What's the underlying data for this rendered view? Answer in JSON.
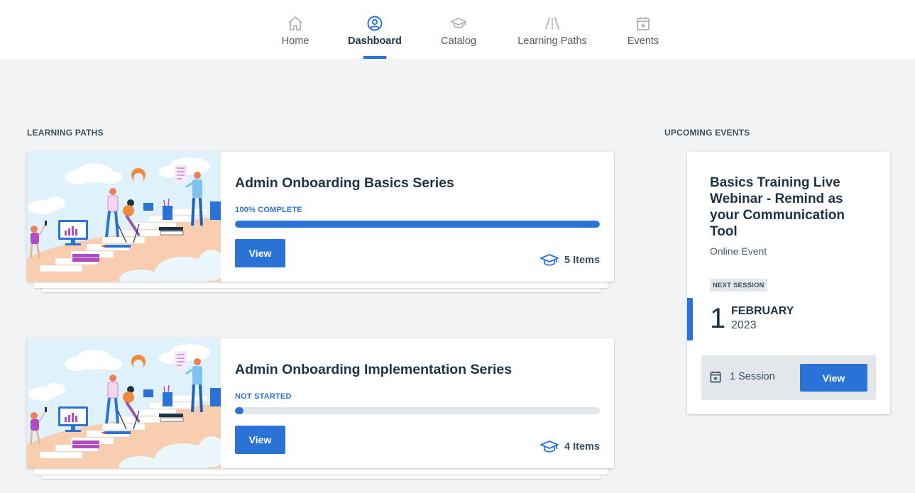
{
  "nav": {
    "items": [
      {
        "label": "Home",
        "icon": "home-icon",
        "active": false
      },
      {
        "label": "Dashboard",
        "icon": "user-circle-icon",
        "active": true
      },
      {
        "label": "Catalog",
        "icon": "graduation-cap-icon",
        "active": false
      },
      {
        "label": "Learning Paths",
        "icon": "road-icon",
        "active": false
      },
      {
        "label": "Events",
        "icon": "calendar-star-icon",
        "active": false
      }
    ]
  },
  "learning_paths": {
    "heading": "LEARNING PATHS",
    "items": [
      {
        "title": "Admin Onboarding Basics Series",
        "status": "100% COMPLETE",
        "progress": 1.0,
        "button": "View",
        "items_count": "5 Items"
      },
      {
        "title": "Admin Onboarding Implementation Series",
        "status": "NOT STARTED",
        "progress": 0.0,
        "button": "View",
        "items_count": "4 Items"
      }
    ]
  },
  "upcoming_events": {
    "heading": "UPCOMING EVENTS",
    "event": {
      "title": "Basics Training Live Webinar - Remind as your Communication Tool",
      "type": "Online Event",
      "badge": "NEXT SESSION",
      "day": "1",
      "month": "FEBRUARY",
      "year": "2023",
      "sessions": "1 Session",
      "button": "View"
    }
  },
  "colors": {
    "accent": "#2a72d6",
    "text_dark": "#1d3446",
    "background": "#f1f3f5",
    "track": "#e3e7eb"
  }
}
